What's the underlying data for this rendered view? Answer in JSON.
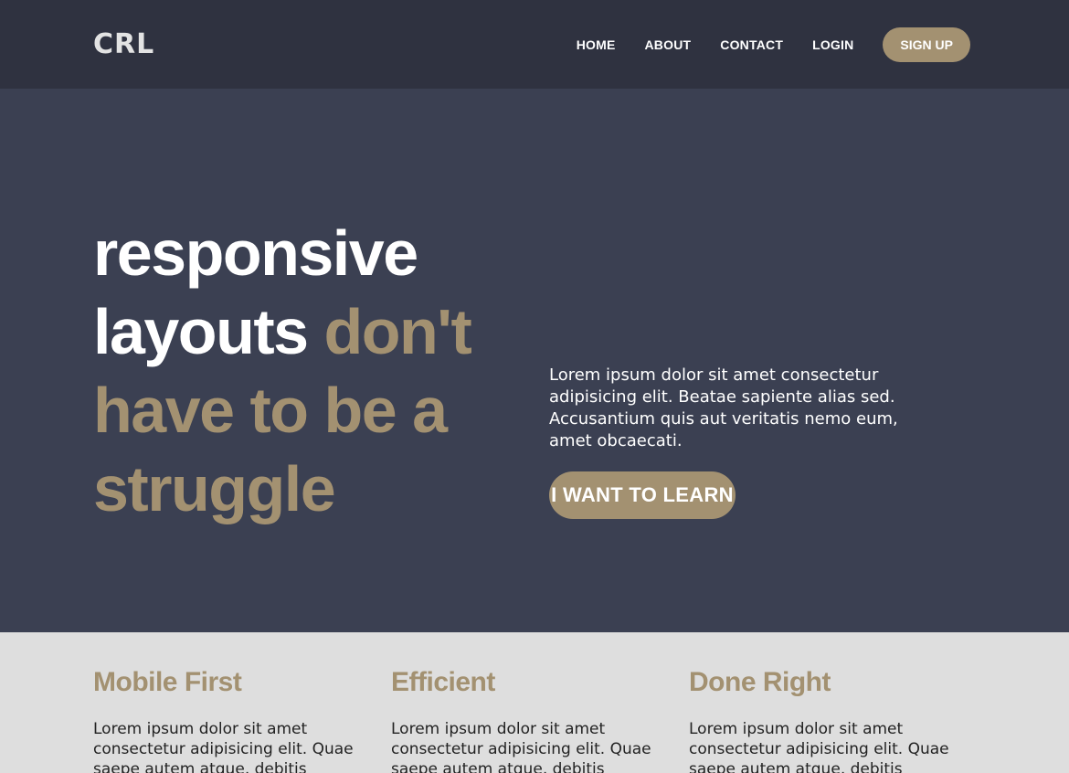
{
  "header": {
    "logo": "CRL",
    "nav": [
      "HOME",
      "ABOUT",
      "CONTACT",
      "LOGIN"
    ],
    "signup_label": "SIGN UP"
  },
  "hero": {
    "title_white_1": "responsive",
    "title_white_2": "layouts",
    "title_accent_1": "don't",
    "title_accent_2": "have to be a",
    "title_accent_3": "struggle",
    "description": "Lorem ipsum dolor sit amet consectetur adipisicing elit. Beatae sapiente alias sed. Accusantium quis aut veritatis nemo eum, amet obcaecati.",
    "cta_label": "I WANT TO LEARN"
  },
  "features": [
    {
      "title": "Mobile First",
      "text": "Lorem ipsum dolor sit amet consectetur adipisicing elit. Quae saepe autem atque, debitis"
    },
    {
      "title": "Efficient",
      "text": "Lorem ipsum dolor sit amet consectetur adipisicing elit. Quae saepe autem atque, debitis"
    },
    {
      "title": "Done Right",
      "text": "Lorem ipsum dolor sit amet consectetur adipisicing elit. Quae saepe autem atque, debitis"
    }
  ],
  "colors": {
    "header_bg": "#2f3240",
    "hero_bg": "#3b4052",
    "accent": "#a39171",
    "features_bg": "#dedede"
  }
}
